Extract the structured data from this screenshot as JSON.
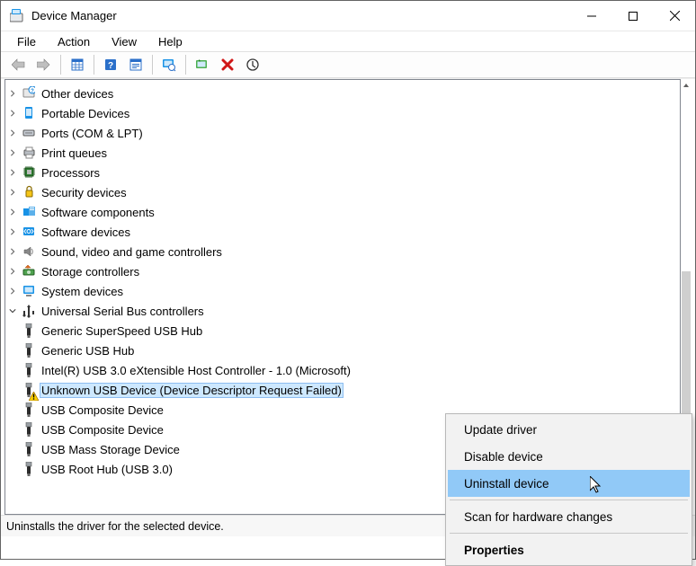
{
  "window": {
    "title": "Device Manager"
  },
  "menu": {
    "file": "File",
    "action": "Action",
    "view": "View",
    "help": "Help"
  },
  "tree": {
    "nodes": [
      {
        "label": "Other devices",
        "icon": "other"
      },
      {
        "label": "Portable Devices",
        "icon": "portable"
      },
      {
        "label": "Ports (COM & LPT)",
        "icon": "ports"
      },
      {
        "label": "Print queues",
        "icon": "printer"
      },
      {
        "label": "Processors",
        "icon": "cpu"
      },
      {
        "label": "Security devices",
        "icon": "security"
      },
      {
        "label": "Software components",
        "icon": "swcomp"
      },
      {
        "label": "Software devices",
        "icon": "swdev"
      },
      {
        "label": "Sound, video and game controllers",
        "icon": "sound"
      },
      {
        "label": "Storage controllers",
        "icon": "storage"
      },
      {
        "label": "System devices",
        "icon": "system"
      },
      {
        "label": "Universal Serial Bus controllers",
        "icon": "usbhost",
        "expanded": true,
        "children": [
          {
            "label": "Generic SuperSpeed USB Hub",
            "icon": "usb"
          },
          {
            "label": "Generic USB Hub",
            "icon": "usb"
          },
          {
            "label": "Intel(R) USB 3.0 eXtensible Host Controller - 1.0 (Microsoft)",
            "icon": "usb"
          },
          {
            "label": "Unknown USB Device (Device Descriptor Request Failed)",
            "icon": "usb",
            "warning": true,
            "selected": true
          },
          {
            "label": "USB Composite Device",
            "icon": "usb"
          },
          {
            "label": "USB Composite Device",
            "icon": "usb"
          },
          {
            "label": "USB Mass Storage Device",
            "icon": "usb"
          },
          {
            "label": "USB Root Hub (USB 3.0)",
            "icon": "usb"
          }
        ]
      }
    ]
  },
  "statusbar": {
    "text": "Uninstalls the driver for the selected device."
  },
  "contextmenu": {
    "items": [
      {
        "label": "Update driver"
      },
      {
        "label": "Disable device"
      },
      {
        "label": "Uninstall device",
        "highlight": true
      },
      {
        "sep": true
      },
      {
        "label": "Scan for hardware changes"
      },
      {
        "sep": true
      },
      {
        "label": "Properties",
        "bold": true
      }
    ]
  }
}
